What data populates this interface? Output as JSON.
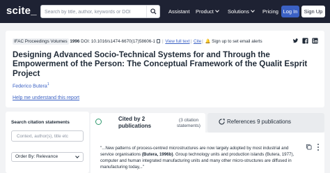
{
  "nav": {
    "logo": "scite_",
    "search_placeholder": "Search by title, author, keywords or DOI",
    "links": {
      "assistant": "Assistant",
      "product": "Product",
      "solutions": "Solutions",
      "pricing": "Pricing"
    },
    "login": "Log In",
    "signup": "Sign Up"
  },
  "article": {
    "journal": "IFAC Proceedings Volumes",
    "volume": "1996",
    "doi": "DOI: 10.1016/s1474-6670(17)58606-1",
    "view_full_text": "View full text",
    "cite": "Cite",
    "alerts": "Sign up to set email alerts",
    "title": "Designing Advanced Socio-Technical Systems for and Through the Empowerment of the Person: The Conceptual Framework of the Qualit Esprit Project",
    "author": "Federico Butera",
    "author_sup": "1",
    "help": "Help me understand this report"
  },
  "left_panel": {
    "heading": "Search citation statements",
    "search_placeholder": "Context, author(s), title etc",
    "order_by": "Order By: Relevance"
  },
  "tabs": {
    "cited_by": "Cited by 2 publications",
    "cited_statements": "(3 citation statements)",
    "references": "References 9 publications"
  },
  "citation": {
    "pre": "\"...New patterns of process-centred microstructures are now largely adopted by most industrial and service organisations ",
    "ref": "(Butera, 1996b)",
    "post": ". Group technology units and production islands (Butera, 1977), computer and human integrated manufacturing units and many other micro-structures are diffused in manufacturing today,..\""
  },
  "colors": {
    "nav_bg": "#1e2233",
    "accent_blue": "#3b61c4",
    "cited_green": "#2f9a6e"
  }
}
